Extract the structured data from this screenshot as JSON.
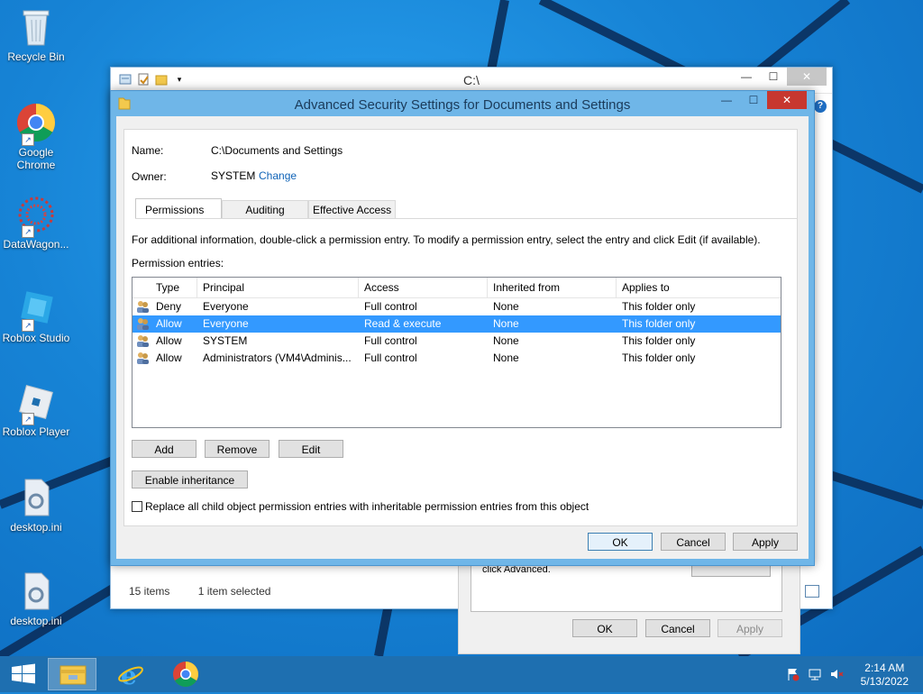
{
  "desktop": {
    "icons": [
      {
        "label": "Recycle Bin"
      },
      {
        "label": "Google Chrome"
      },
      {
        "label": "DataWagon..."
      },
      {
        "label": "Roblox Studio"
      },
      {
        "label": "Roblox Player"
      },
      {
        "label": "desktop.ini"
      },
      {
        "label": "desktop.ini"
      }
    ]
  },
  "explorer": {
    "title": "C:\\",
    "status_items": "15 items",
    "status_selected": "1 item selected"
  },
  "properties": {
    "hint": "click Advanced.",
    "ok": "OK",
    "cancel": "Cancel",
    "apply": "Apply"
  },
  "dialog": {
    "title": "Advanced Security Settings for Documents and Settings",
    "name_label": "Name:",
    "name_value": "C:\\Documents and Settings",
    "owner_label": "Owner:",
    "owner_value": "SYSTEM",
    "owner_change": "Change",
    "tabs": [
      "Permissions",
      "Auditing",
      "Effective Access"
    ],
    "info": "For additional information, double-click a permission entry. To modify a permission entry, select the entry and click Edit (if available).",
    "entries_label": "Permission entries:",
    "columns": [
      "Type",
      "Principal",
      "Access",
      "Inherited from",
      "Applies to"
    ],
    "rows": [
      {
        "type": "Deny",
        "principal": "Everyone",
        "access": "Full control",
        "inherited": "None",
        "applies": "This folder only"
      },
      {
        "type": "Allow",
        "principal": "Everyone",
        "access": "Read & execute",
        "inherited": "None",
        "applies": "This folder only"
      },
      {
        "type": "Allow",
        "principal": "SYSTEM",
        "access": "Full control",
        "inherited": "None",
        "applies": "This folder only"
      },
      {
        "type": "Allow",
        "principal": "Administrators (VM4\\Adminis...",
        "access": "Full control",
        "inherited": "None",
        "applies": "This folder only"
      }
    ],
    "add": "Add",
    "remove": "Remove",
    "edit": "Edit",
    "enable_inheritance": "Enable inheritance",
    "replace_label": "Replace all child object permission entries with inheritable permission entries from this object",
    "ok": "OK",
    "cancel": "Cancel",
    "apply": "Apply"
  },
  "taskbar": {
    "time": "2:14 AM",
    "date": "5/13/2022"
  },
  "colors": {
    "selection": "#3399ff",
    "link": "#0f63b7",
    "dialog_frame": "#6fb6e8",
    "close_red": "#c7372f",
    "taskbar": "#1e6fb0"
  }
}
